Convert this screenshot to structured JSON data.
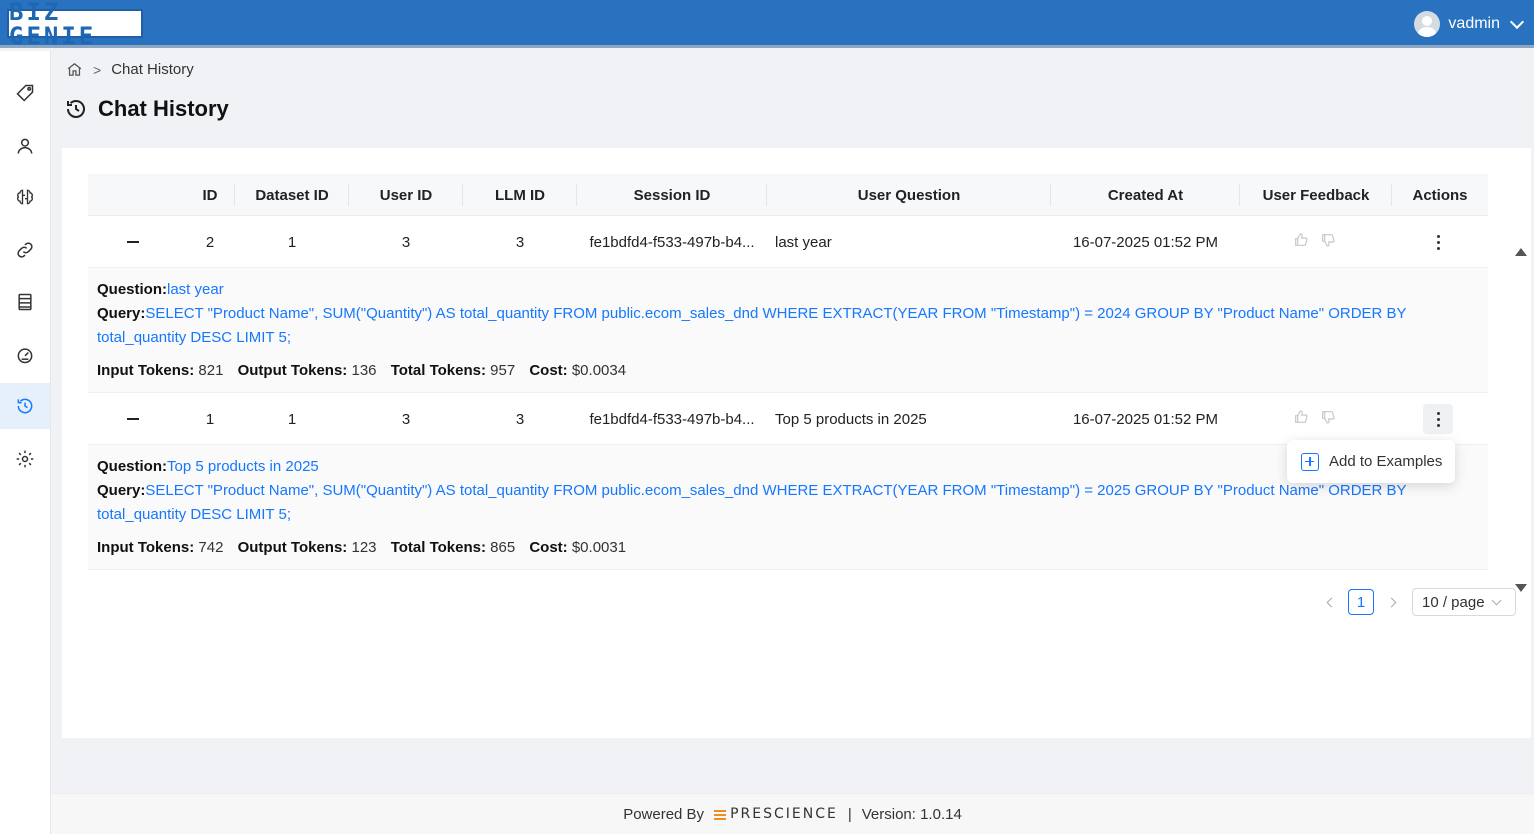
{
  "app": {
    "logo_text": "BIZ GENIE",
    "username": "vadmin"
  },
  "breadcrumb": {
    "current": "Chat History"
  },
  "page": {
    "title": "Chat History"
  },
  "table": {
    "headers": {
      "id": "ID",
      "dataset_id": "Dataset ID",
      "user_id": "User ID",
      "llm_id": "LLM ID",
      "session_id": "Session ID",
      "user_question": "User Question",
      "created_at": "Created At",
      "user_feedback": "User Feedback",
      "actions": "Actions"
    },
    "rows": [
      {
        "id": "2",
        "dataset_id": "1",
        "user_id": "3",
        "llm_id": "3",
        "session_id": "fe1bdfd4-f533-497b-b4...",
        "user_question": "last year",
        "created_at": "16-07-2025 01:52 PM",
        "detail": {
          "question_label": "Question:",
          "question": "last year",
          "query_label": "Query:",
          "query": "SELECT \"Product Name\", SUM(\"Quantity\") AS total_quantity FROM public.ecom_sales_dnd WHERE EXTRACT(YEAR FROM \"Timestamp\") = 2024 GROUP BY \"Product Name\" ORDER BY total_quantity DESC LIMIT 5;",
          "input_tokens_label": "Input Tokens:",
          "input_tokens": "821",
          "output_tokens_label": "Output Tokens:",
          "output_tokens": "136",
          "total_tokens_label": "Total Tokens:",
          "total_tokens": "957",
          "cost_label": "Cost:",
          "cost": "$0.0034"
        }
      },
      {
        "id": "1",
        "dataset_id": "1",
        "user_id": "3",
        "llm_id": "3",
        "session_id": "fe1bdfd4-f533-497b-b4...",
        "user_question": "Top 5 products in 2025",
        "created_at": "16-07-2025 01:52 PM",
        "detail": {
          "question_label": "Question:",
          "question": "Top 5 products in 2025",
          "query_label": "Query:",
          "query": "SELECT \"Product Name\", SUM(\"Quantity\") AS total_quantity FROM public.ecom_sales_dnd WHERE EXTRACT(YEAR FROM \"Timestamp\") = 2025 GROUP BY \"Product Name\" ORDER BY total_quantity DESC LIMIT 5;",
          "input_tokens_label": "Input Tokens:",
          "input_tokens": "742",
          "output_tokens_label": "Output Tokens:",
          "output_tokens": "123",
          "total_tokens_label": "Total Tokens:",
          "total_tokens": "865",
          "cost_label": "Cost:",
          "cost": "$0.0031"
        }
      }
    ]
  },
  "actions_menu": {
    "add_to_examples": "Add to Examples"
  },
  "pagination": {
    "current_page": "1",
    "page_size": "10 / page"
  },
  "footer": {
    "powered_by": "Powered By",
    "brand": "PRESCIENCE",
    "separator": "|",
    "version": "Version: 1.0.14"
  },
  "colors": {
    "header_blue": "#2872c0",
    "link_blue": "#1677ff",
    "brand_orange": "#f08c1f"
  },
  "icons": {
    "sidebar": [
      "tag-icon",
      "user-icon",
      "brain-icon",
      "link-icon",
      "database-icon",
      "dashboard-icon",
      "history-icon",
      "settings-icon"
    ]
  }
}
